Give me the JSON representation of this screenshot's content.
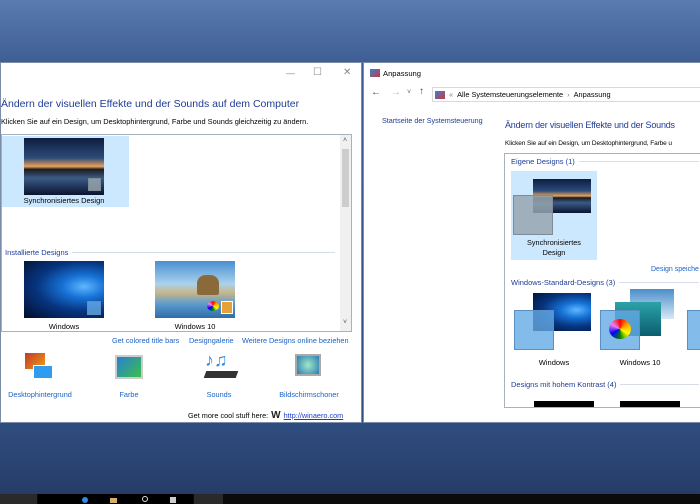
{
  "left_window": {
    "controls": {
      "minimize": "—",
      "maximize": "☐",
      "close": "✕"
    },
    "heading": "Ändern der visuellen Effekte und der Sounds auf dem Computer",
    "subtitle": "Klicken Sie auf ein Design, um Desktophintergrund, Farbe und Sounds gleichzeitig zu ändern.",
    "my_theme": {
      "label": "Synchronisiertes Design",
      "selected": true
    },
    "installed_group": "Installierte Designs",
    "installed": [
      {
        "label": "Windows"
      },
      {
        "label": "Windows 10"
      }
    ],
    "links": [
      "Get colored title bars",
      "Designgalerie",
      "Weitere Designs online beziehen"
    ],
    "bottom_items": [
      {
        "label": "Desktophintergrund",
        "icon": "desktop-background-icon"
      },
      {
        "label": "Farbe",
        "icon": "color-icon"
      },
      {
        "label": "Sounds",
        "icon": "sounds-icon"
      },
      {
        "label": "Bildschirmschoner",
        "icon": "screensaver-icon"
      }
    ],
    "footer": {
      "text": "Get more cool stuff here:",
      "logo": "W",
      "url": "http://winaero.com"
    }
  },
  "right_window": {
    "title": "Anpassung",
    "address": {
      "prefix": "«",
      "crumbs": [
        "Alle Systemsteuerungselemente",
        "Anpassung"
      ],
      "separator": "›"
    },
    "sidebar_link": "Startseite der Systemsteuerung",
    "heading": "Ändern der visuellen Effekte und der Sounds",
    "subtitle": "Klicken Sie auf ein Design, um Desktophintergrund, Farbe u",
    "groups": {
      "own": "Eigene Designs (1)",
      "standard": "Windows-Standard-Designs (3)",
      "contrast": "Designs mit hohem Kontrast (4)"
    },
    "own_theme": {
      "line1": "Synchronisiertes",
      "line2": "Design",
      "selected": true
    },
    "save_link": "Design speiche",
    "standard_themes": [
      {
        "label": "Windows"
      },
      {
        "label": "Windows 10"
      }
    ]
  },
  "colors": {
    "accent": "#1e3c96",
    "link": "#1a62c7",
    "selection": "#cce8ff",
    "taskbar": "#0b0b0b"
  }
}
